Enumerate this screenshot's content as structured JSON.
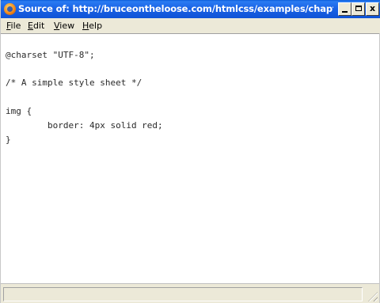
{
  "window": {
    "title": "Source of: http://bruceontheloose.com/htmlcss/examples/chapte...",
    "controls": {
      "minimize_icon": "minimize-icon",
      "maximize_icon": "maximize-icon",
      "close_label": "x"
    }
  },
  "menu": {
    "items": [
      {
        "label": "File"
      },
      {
        "label": "Edit"
      },
      {
        "label": "View"
      },
      {
        "label": "Help"
      }
    ]
  },
  "source": {
    "lines": [
      "@charset \"UTF-8\";",
      "/* A simple style sheet */",
      "img {",
      "        border: 4px solid red;",
      "}"
    ]
  },
  "statusbar": {
    "text": "",
    "grip_icon": "resize-grip-icon"
  },
  "colors": {
    "titlebar": "#0f53d6",
    "chrome": "#ece9d8",
    "content_background": "#ffffff",
    "code_text": "#2a2a2a"
  }
}
